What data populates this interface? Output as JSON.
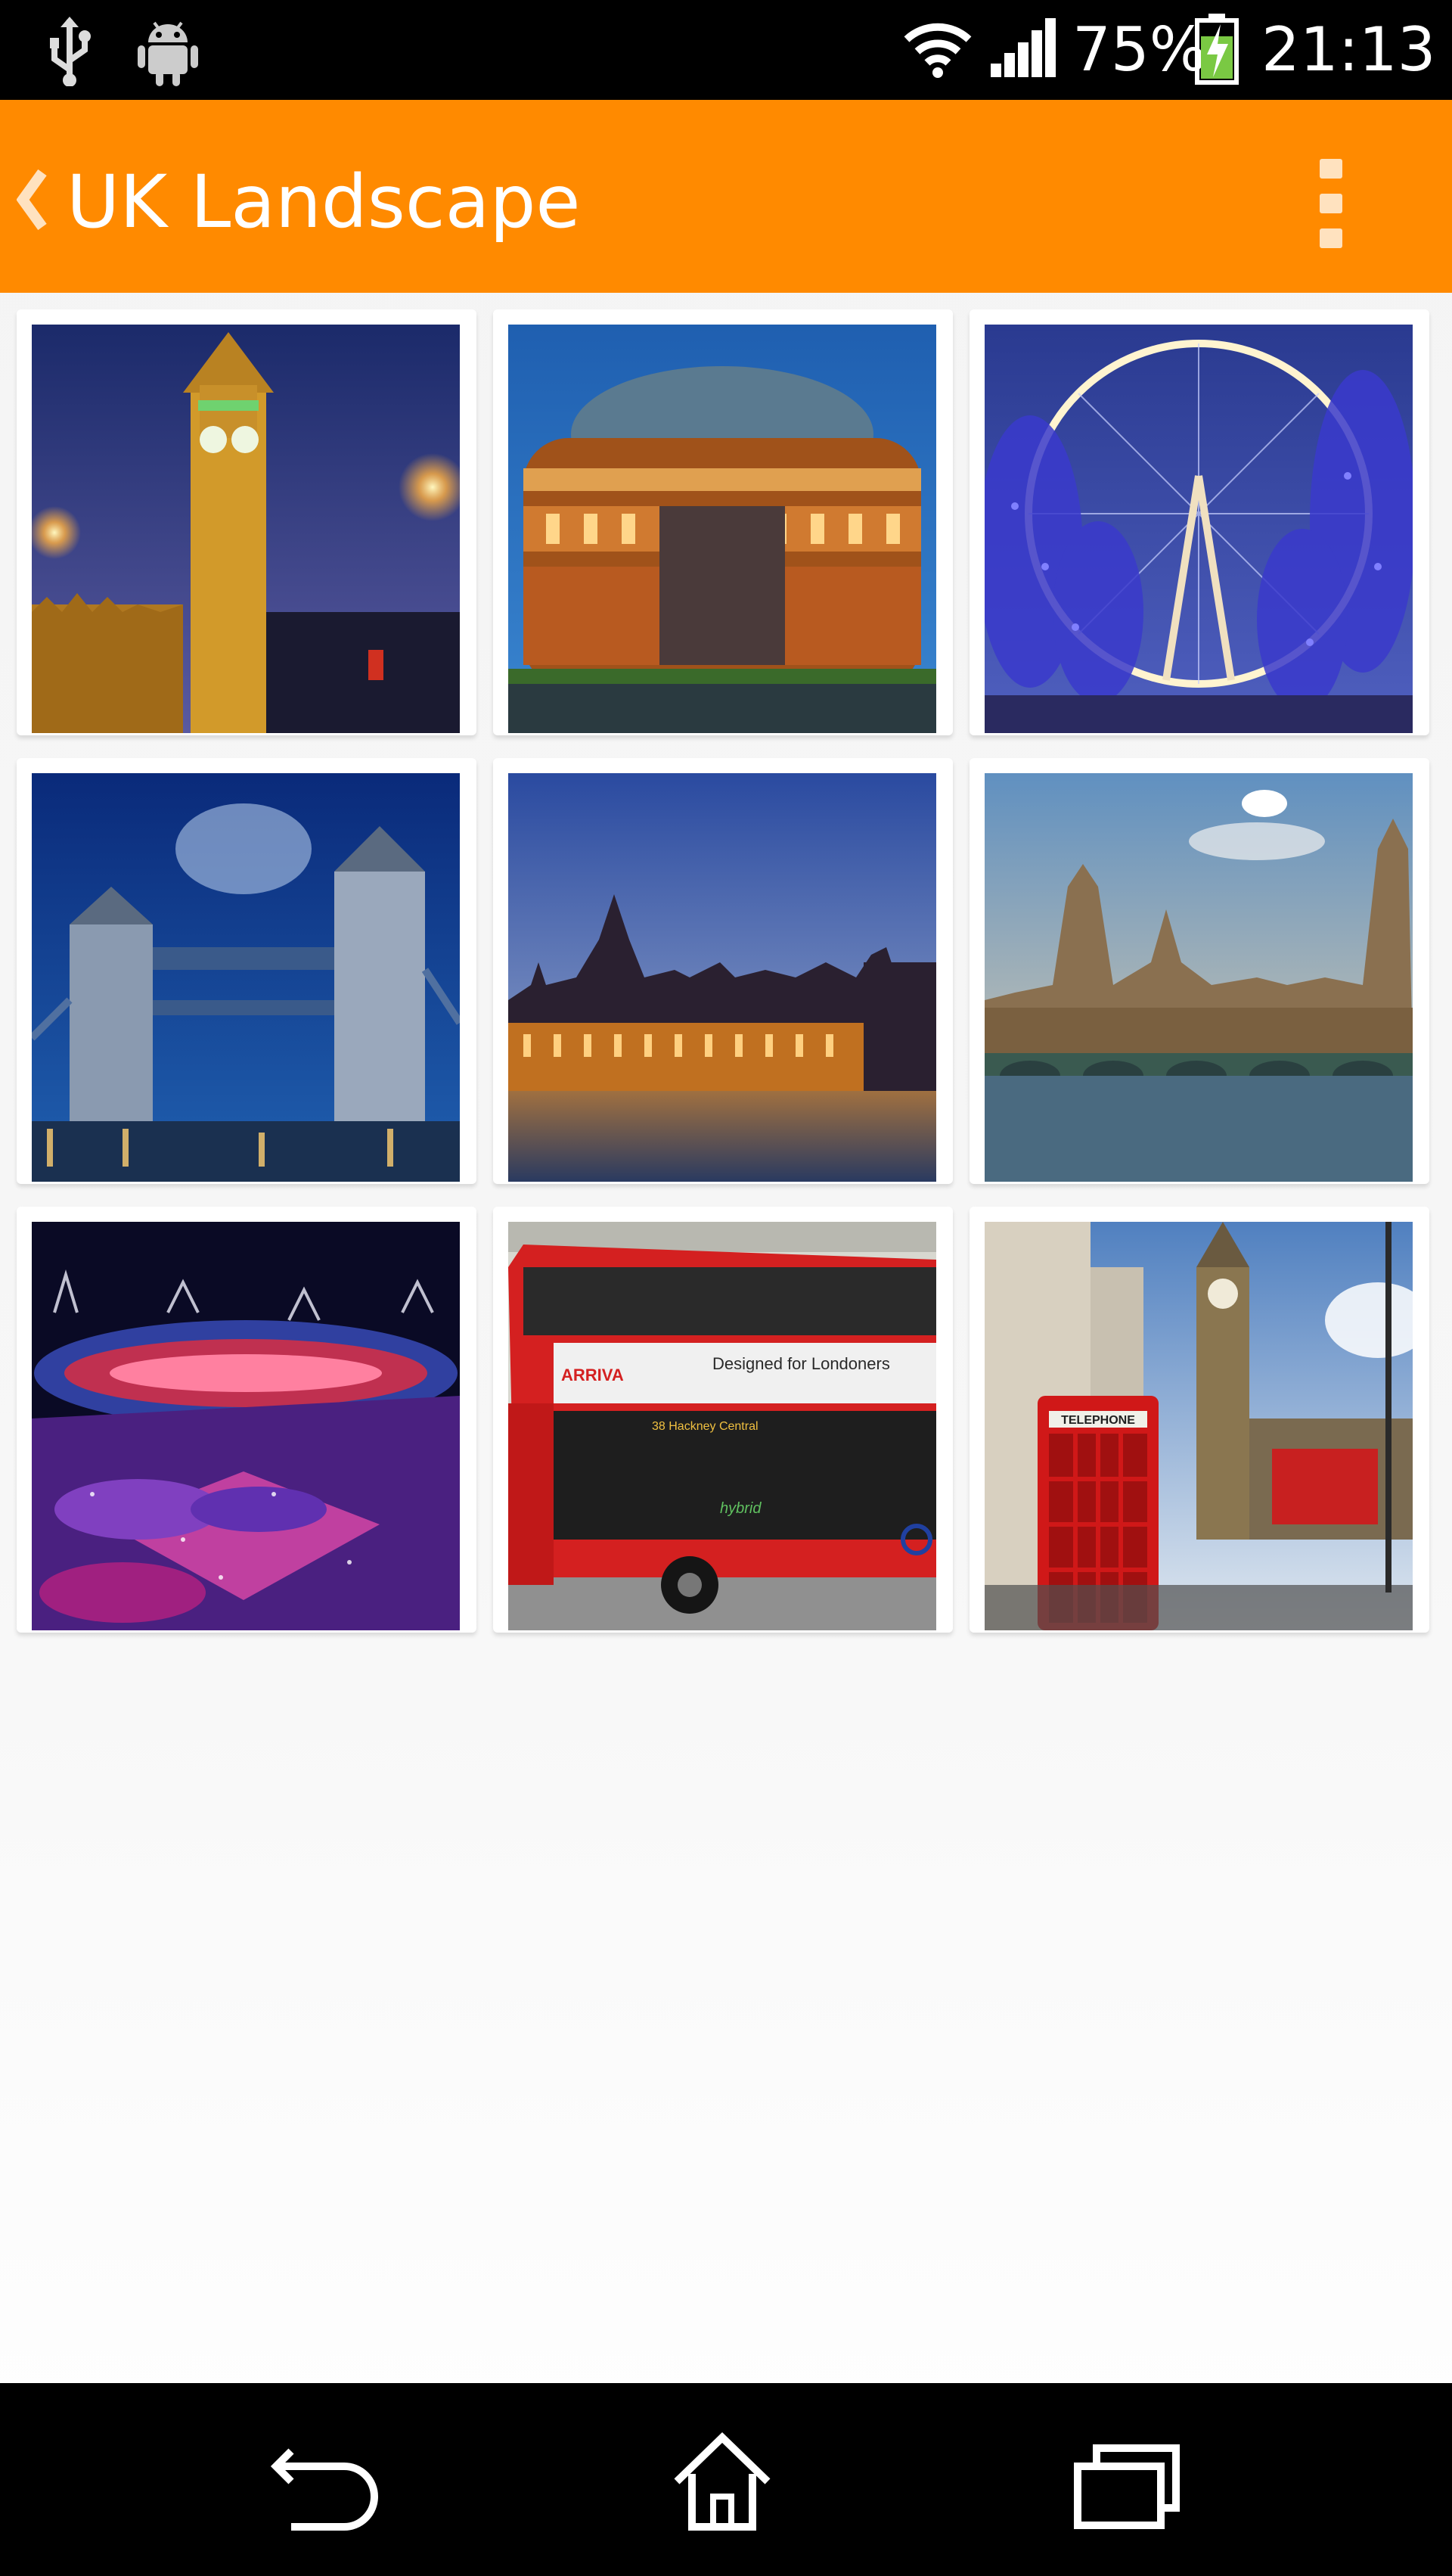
{
  "status_bar": {
    "battery_percent": "75%",
    "time": "21:13",
    "icons": [
      "usb-icon",
      "android-debug-icon",
      "wifi-icon",
      "cell-signal-icon",
      "battery-charging-icon"
    ]
  },
  "action_bar": {
    "title": "UK Landscape",
    "icons": [
      "back-chevron-icon",
      "overflow-menu-icon"
    ],
    "color": "#ff8a00"
  },
  "gallery": {
    "photos": [
      {
        "subject": "big-ben-night"
      },
      {
        "subject": "royal-albert-hall"
      },
      {
        "subject": "london-eye"
      },
      {
        "subject": "tower-bridge"
      },
      {
        "subject": "houses-of-parliament-dusk"
      },
      {
        "subject": "westminster-bridge"
      },
      {
        "subject": "olympic-stadium"
      },
      {
        "subject": "red-double-decker-bus",
        "text": {
          "operator": "ARRIVA",
          "ad": "Designed for Londoners",
          "route": "38 Hackney Central",
          "brand": "hybrid"
        }
      },
      {
        "subject": "red-telephone-box",
        "text": {
          "sign": "TELEPHONE"
        }
      }
    ]
  },
  "nav_bar": {
    "icons": [
      "back-icon",
      "home-icon",
      "recent-apps-icon"
    ]
  }
}
